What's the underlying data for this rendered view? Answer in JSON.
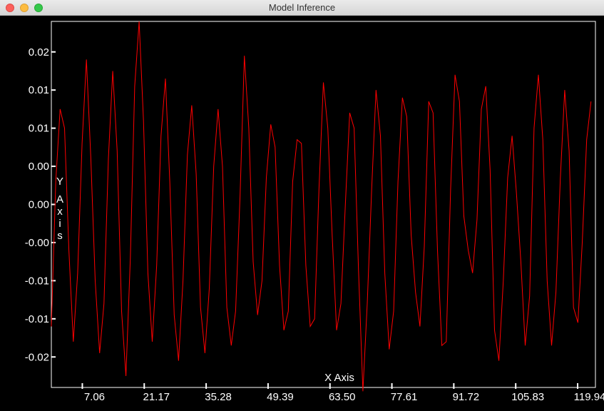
{
  "window": {
    "title": "Model Inference"
  },
  "chart_data": {
    "type": "line",
    "xlabel": "X Axis",
    "ylabel": "Y Axis",
    "xlim": [
      0,
      124
    ],
    "ylim": [
      -0.024,
      0.024
    ],
    "x_tick_values": [
      7.06,
      21.17,
      35.28,
      49.39,
      63.5,
      77.61,
      91.72,
      105.83,
      119.94
    ],
    "x_tick_labels": [
      "7.06",
      "21.17",
      "35.28",
      "49.39",
      "63.50",
      "77.61",
      "91.72",
      "105.83",
      "119.94"
    ],
    "y_tick_values": [
      0.02,
      0.015,
      0.01,
      0.005,
      0.0,
      -0.005,
      -0.01,
      -0.015,
      -0.02
    ],
    "y_tick_labels": [
      "0.02",
      "0.01",
      "0.01",
      "0.00",
      "0.00",
      "-0.00",
      "-0.01",
      "-0.01",
      "-0.02"
    ],
    "series": [
      {
        "color": "#ff0000",
        "x": [
          0,
          1,
          2,
          3,
          4,
          5,
          6,
          7,
          8,
          9,
          10,
          11,
          12,
          13,
          14,
          15,
          16,
          17,
          18,
          19,
          20,
          21,
          22,
          23,
          24,
          25,
          26,
          27,
          28,
          29,
          30,
          31,
          32,
          33,
          34,
          35,
          36,
          37,
          38,
          39,
          40,
          41,
          42,
          43,
          44,
          45,
          46,
          47,
          48,
          49,
          50,
          51,
          52,
          53,
          54,
          55,
          56,
          57,
          58,
          59,
          60,
          61,
          62,
          63,
          64,
          65,
          66,
          67,
          68,
          69,
          70,
          71,
          72,
          73,
          74,
          75,
          76,
          77,
          78,
          79,
          80,
          81,
          82,
          83,
          84,
          85,
          86,
          87,
          88,
          89,
          90,
          91,
          92,
          93,
          94,
          95,
          96,
          97,
          98,
          99,
          100,
          101,
          102,
          103,
          104,
          105,
          106,
          107,
          108,
          109,
          110,
          111,
          112,
          113,
          114,
          115,
          116,
          117,
          118,
          119,
          120,
          121,
          122,
          123
        ],
        "y": [
          -0.016,
          0.003,
          0.0125,
          0.01,
          -0.006,
          -0.018,
          -0.009,
          0.008,
          0.019,
          0.006,
          -0.01,
          -0.0195,
          -0.013,
          0.006,
          0.0175,
          0.007,
          -0.014,
          -0.0225,
          -0.007,
          0.0155,
          0.024,
          0.011,
          -0.009,
          -0.018,
          -0.008,
          0.009,
          0.0165,
          0.003,
          -0.0145,
          -0.0205,
          -0.01,
          0.0065,
          0.013,
          0.004,
          -0.0135,
          -0.0195,
          -0.011,
          0.005,
          0.0125,
          0.005,
          -0.0135,
          -0.0185,
          -0.014,
          0.001,
          0.0195,
          0.01,
          -0.0075,
          -0.0145,
          -0.01,
          0.0035,
          0.0105,
          0.0075,
          -0.008,
          -0.0165,
          -0.014,
          0.003,
          0.0085,
          0.008,
          -0.008,
          -0.016,
          -0.015,
          0.002,
          0.016,
          0.01,
          -0.004,
          -0.0165,
          -0.013,
          0.0,
          0.012,
          0.01,
          -0.0085,
          -0.0245,
          -0.013,
          0.002,
          0.015,
          0.009,
          -0.009,
          -0.019,
          -0.014,
          0.003,
          0.014,
          0.0115,
          -0.004,
          -0.0115,
          -0.016,
          -0.0055,
          0.0135,
          0.012,
          -0.006,
          -0.0185,
          -0.018,
          0.002,
          0.017,
          0.0135,
          -0.0015,
          -0.006,
          -0.009,
          -0.002,
          0.0125,
          0.0155,
          0.0045,
          -0.0165,
          -0.0205,
          -0.01,
          0.0035,
          0.009,
          0.0015,
          -0.0075,
          -0.0185,
          -0.012,
          0.01,
          0.017,
          0.0085,
          -0.01,
          -0.0185,
          -0.0115,
          0.0035,
          0.015,
          0.007,
          -0.0135,
          -0.0155,
          -0.005,
          0.0085,
          0.0135
        ]
      }
    ]
  }
}
